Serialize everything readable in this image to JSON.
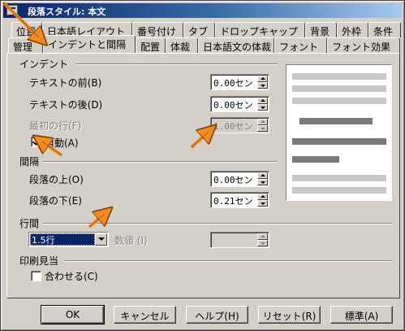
{
  "window": {
    "title": "段落スタイル: 本文"
  },
  "tabs_row1": [
    {
      "label": "位置"
    },
    {
      "label": "日本語レイアウト"
    },
    {
      "label": "番号付け"
    },
    {
      "label": "タブ"
    },
    {
      "label": "ドロップキャップ"
    },
    {
      "label": "背景"
    },
    {
      "label": "外枠"
    },
    {
      "label": "条件"
    }
  ],
  "tabs_row2": [
    {
      "label": "管理"
    },
    {
      "label": "インデントと間隔"
    },
    {
      "label": "配置"
    },
    {
      "label": "体裁"
    },
    {
      "label": "日本語文の体裁"
    },
    {
      "label": "フォント"
    },
    {
      "label": "フォント効果"
    }
  ],
  "indent": {
    "heading": "インデント",
    "before_label": "テキストの前(B)",
    "before_value": "0.00セン",
    "after_label": "テキストの後(D)",
    "after_value": "0.00セン",
    "first_line_label": "最初の行(F)",
    "first_line_value": "1.00セン",
    "auto_label": "自動(A)",
    "auto_checked": true
  },
  "spacing": {
    "heading": "間隔",
    "above_label": "段落の上(O)",
    "above_value": "0.00セン",
    "below_label": "段落の下(E)",
    "below_value": "0.21セン"
  },
  "line_spacing": {
    "heading": "行間",
    "selected": "1.5行",
    "value_label": "数値 (I)",
    "value": ""
  },
  "register": {
    "heading": "印刷見当",
    "fit_label": "合わせる(C)",
    "fit_checked": false
  },
  "buttons": {
    "ok": "OK",
    "cancel": "キャンセル",
    "help": "ヘルプ(H)",
    "reset": "リセット(R)",
    "standard": "標準(A)"
  },
  "colors": {
    "title_start": "#0a246a",
    "title_end": "#a6caf0",
    "face": "#d4d0c8",
    "selection": "#0a246a",
    "annotation_arrow": "#f58a1f",
    "preview_light": "#c8c8c8",
    "preview_dark": "#7a7a7a"
  }
}
